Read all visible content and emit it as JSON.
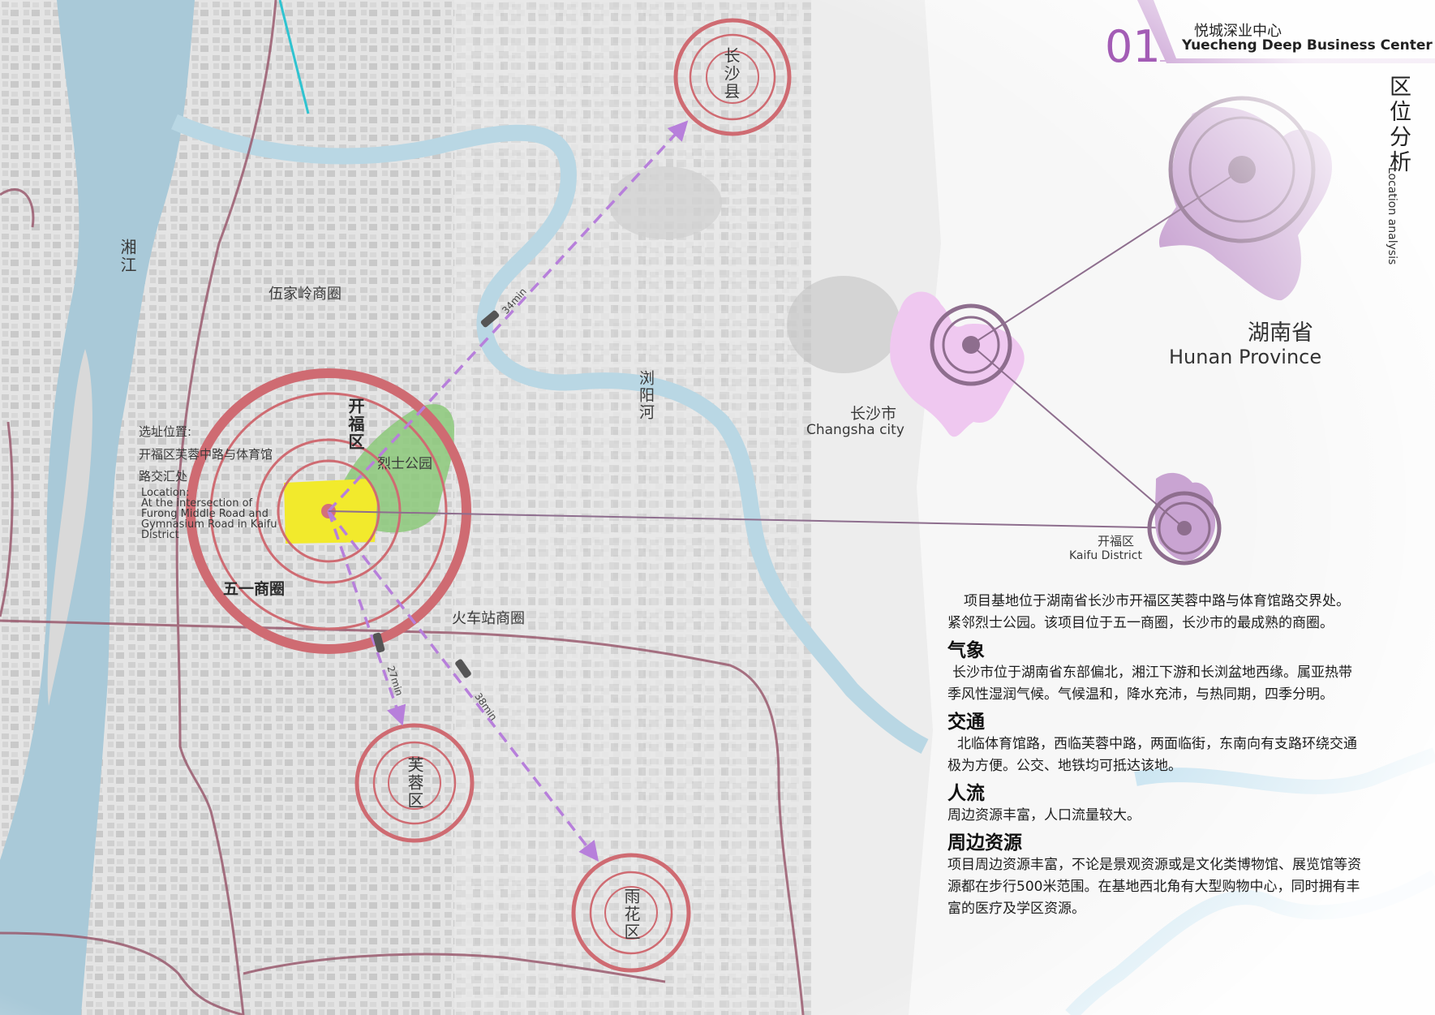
{
  "header": {
    "number": "01",
    "title_cn": "悦城深业中心",
    "title_en": "Yuecheng Deep Business Center",
    "section_cn": "区位分析",
    "section_en": "Location analysis"
  },
  "map": {
    "rivers": {
      "xiangjiang": "湘江",
      "liuyanghe": "浏阳河"
    },
    "districts": {
      "changsha_county": "长沙县",
      "kaifu": "开福区",
      "furong": "芙蓉区",
      "yuhua": "雨花区"
    },
    "areas": {
      "wujialing": "伍家岭商圈",
      "wuyi": "五一商圈",
      "train_station": "火车站商圈",
      "martyrs_park": "烈士公园"
    },
    "site": {
      "cn_title": "选址位置:",
      "cn_line1": "开福区芙蓉中路与体育馆",
      "cn_line2": "路交汇处",
      "en_title": "Location:",
      "en_line1": "At the intersection of",
      "en_line2": "Furong Middle Road and",
      "en_line3": "Gymnasium Road in Kaifu",
      "en_line4": "District"
    },
    "travel_times": {
      "to_changsha_county": "34min",
      "to_furong": "27min",
      "to_yuhua": "38min"
    },
    "insets": {
      "province_cn": "湖南省",
      "province_en": "Hunan Province",
      "city_cn": "长沙市",
      "city_en": "Changsha city",
      "district_cn": "开福区",
      "district_en": "Kaifu District"
    },
    "colors": {
      "river": "#b9d7e4",
      "river_fill": "#a9c9d8",
      "ring": "#cf6b72",
      "road": "#9a5a6e",
      "arrow": "#b77fdb",
      "site": "#f2ea2c",
      "park": "#8cc97a",
      "accent": "#a35cb5",
      "province": "#c9a4d2",
      "city": "#efc8f0"
    }
  },
  "description": {
    "intro": "项目基地位于湖南省长沙市开福区芙蓉中路与体育馆路交界处。紧邻烈士公园。该项目位于五一商圈，长沙市的最成熟的商圈。",
    "sections": [
      {
        "heading": "气象",
        "text": "长沙市位于湖南省东部偏北，湘江下游和长浏盆地西缘。属亚热带季风性湿润气候。气候温和，降水充沛，与热同期，四季分明。"
      },
      {
        "heading": "交通",
        "text": "北临体育馆路，西临芙蓉中路，两面临街，东南向有支路环绕交通极为方便。公交、地铁均可抵达该地。"
      },
      {
        "heading": "人流",
        "text": "周边资源丰富，人口流量较大。"
      },
      {
        "heading": "周边资源",
        "text": "项目周边资源丰富，不论是景观资源或是文化类博物馆、展览馆等资源都在步行500米范围。在基地西北角有大型购物中心，同时拥有丰富的医疗及学区资源。"
      }
    ]
  }
}
